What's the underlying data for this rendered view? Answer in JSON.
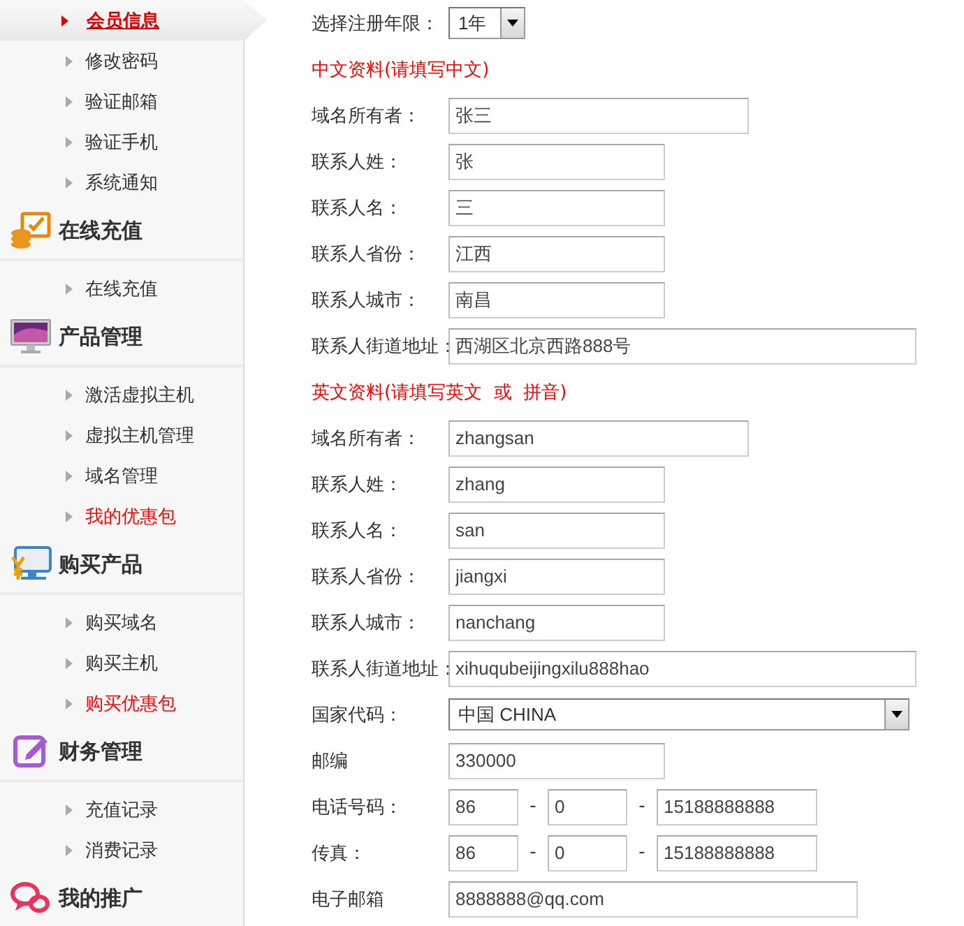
{
  "sidebar": {
    "groups": [
      {
        "items": [
          {
            "label": "会员信息",
            "selected": true,
            "highlighted": false
          },
          {
            "label": "修改密码",
            "selected": false,
            "highlighted": false
          },
          {
            "label": "验证邮箱",
            "selected": false,
            "highlighted": false
          },
          {
            "label": "验证手机",
            "selected": false,
            "highlighted": false
          },
          {
            "label": "系统通知",
            "selected": false,
            "highlighted": false
          }
        ]
      },
      {
        "title": "在线充值",
        "items": [
          {
            "label": "在线充值",
            "selected": false,
            "highlighted": false
          }
        ]
      },
      {
        "title": "产品管理",
        "items": [
          {
            "label": "激活虚拟主机",
            "selected": false,
            "highlighted": false
          },
          {
            "label": "虚拟主机管理",
            "selected": false,
            "highlighted": false
          },
          {
            "label": "域名管理",
            "selected": false,
            "highlighted": false
          },
          {
            "label": "我的优惠包",
            "selected": false,
            "highlighted": true
          }
        ]
      },
      {
        "title": "购买产品",
        "items": [
          {
            "label": "购买域名",
            "selected": false,
            "highlighted": false
          },
          {
            "label": "购买主机",
            "selected": false,
            "highlighted": false
          },
          {
            "label": "购买优惠包",
            "selected": false,
            "highlighted": true
          }
        ]
      },
      {
        "title": "财务管理",
        "items": [
          {
            "label": "充值记录",
            "selected": false,
            "highlighted": false
          },
          {
            "label": "消费记录",
            "selected": false,
            "highlighted": false
          }
        ]
      },
      {
        "title": "我的推广"
      }
    ]
  },
  "form": {
    "period": {
      "label": "选择注册年限：",
      "value": "1年"
    },
    "sections": [
      {
        "title": "中文资料(请填写中文)",
        "fields": [
          {
            "label": "域名所有者：",
            "value": "张三"
          },
          {
            "label": "联系人姓：",
            "value": "张"
          },
          {
            "label": "联系人名：",
            "value": "三"
          },
          {
            "label": "联系人省份：",
            "value": "江西"
          },
          {
            "label": "联系人城市：",
            "value": "南昌"
          },
          {
            "label": "联系人街道地址：",
            "value": "西湖区北京西路888号"
          }
        ]
      },
      {
        "title": "英文资料(请填写英文  或  拼音)",
        "fields": [
          {
            "label": "域名所有者：",
            "value": "zhangsan"
          },
          {
            "label": "联系人姓：",
            "value": "zhang"
          },
          {
            "label": "联系人名：",
            "value": "san"
          },
          {
            "label": "联系人省份：",
            "value": "jiangxi"
          },
          {
            "label": "联系人城市：",
            "value": "nanchang"
          },
          {
            "label": "联系人街道地址：",
            "value": "xihuqubeijingxilu888hao"
          }
        ]
      }
    ],
    "contact": [
      {
        "kind": "select",
        "label": "国家代码：",
        "value": "中国 CHINA"
      },
      {
        "kind": "text",
        "label": "邮编",
        "value": "330000"
      },
      {
        "kind": "phone",
        "label": "电话号码：",
        "parts": [
          "86",
          "0",
          "15188888888"
        ],
        "separator": "-"
      },
      {
        "kind": "phone",
        "label": "传真：",
        "parts": [
          "86",
          "0",
          "15188888888"
        ],
        "separator": "-"
      },
      {
        "kind": "email",
        "label": "电子邮箱",
        "value": "8888888@qq.com"
      }
    ]
  }
}
